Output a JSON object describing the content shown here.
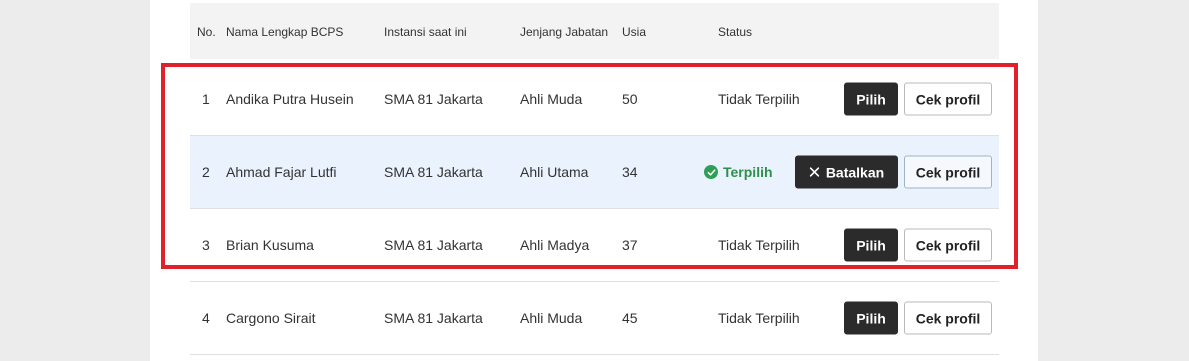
{
  "table": {
    "headers": {
      "no": "No.",
      "name": "Nama Lengkap BCPS",
      "instansi": "Instansi saat ini",
      "jenjang": "Jenjang Jabatan",
      "usia": "Usia",
      "status": "Status"
    },
    "rows": [
      {
        "no": "1",
        "name": "Andika Putra Husein",
        "instansi": "SMA 81 Jakarta",
        "jenjang": "Ahli Muda",
        "usia": "50",
        "status": "Tidak Terpilih",
        "action": "Pilih",
        "profile": "Cek profil",
        "selected": false
      },
      {
        "no": "2",
        "name": "Ahmad Fajar Lutfi",
        "instansi": "SMA 81 Jakarta",
        "jenjang": "Ahli Utama",
        "usia": "34",
        "status": "Terpilih",
        "action": "Batalkan",
        "profile": "Cek profil",
        "selected": true
      },
      {
        "no": "3",
        "name": "Brian Kusuma",
        "instansi": "SMA 81 Jakarta",
        "jenjang": "Ahli Madya",
        "usia": "37",
        "status": "Tidak Terpilih",
        "action": "Pilih",
        "profile": "Cek profil",
        "selected": false
      },
      {
        "no": "4",
        "name": "Cargono Sirait",
        "instansi": "SMA 81 Jakarta",
        "jenjang": "Ahli Muda",
        "usia": "45",
        "status": "Tidak Terpilih",
        "action": "Pilih",
        "profile": "Cek profil",
        "selected": false
      }
    ]
  },
  "colors": {
    "highlight": "#e0212b",
    "selected_row": "#eaf2fd",
    "status_ok": "#2f8f4e",
    "button_dark": "#2b2b2b"
  },
  "icons": {
    "status_ok": "check-circle-icon",
    "cancel": "close-icon"
  }
}
